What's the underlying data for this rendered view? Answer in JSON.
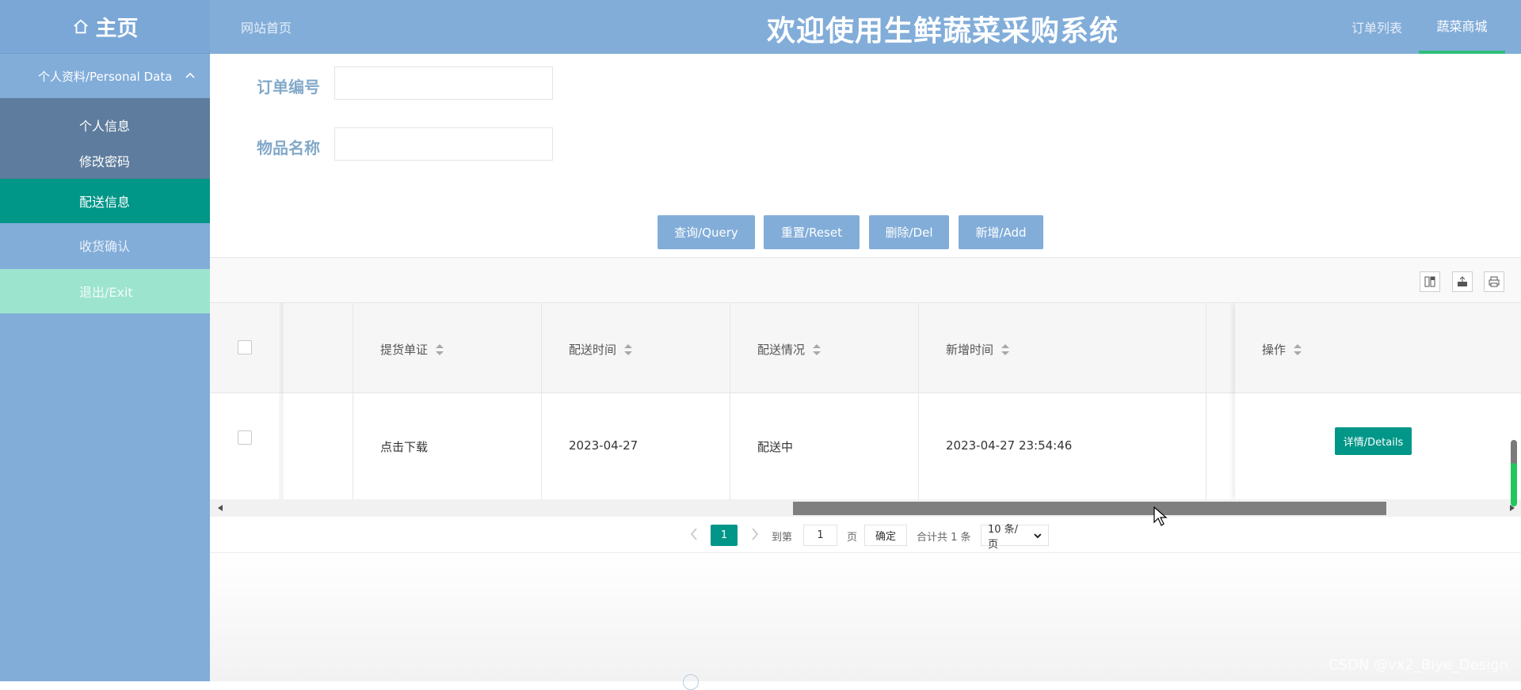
{
  "header": {
    "home_label": "主页",
    "nav_home": "网站首页",
    "title": "欢迎使用生鲜蔬菜采购系统",
    "nav_orders": "订单列表",
    "nav_shop": "蔬菜商城"
  },
  "sidebar": {
    "group_label": "个人资料/Personal Data",
    "sub_items": [
      "个人信息",
      "修改密码"
    ],
    "active_item": "配送信息",
    "receipt_item": "收货确认",
    "exit_item": "退出/Exit"
  },
  "form": {
    "order_no_label": "订单编号",
    "order_no_value": "",
    "item_name_label": "物品名称",
    "item_name_value": ""
  },
  "buttons": {
    "query": "查询/Query",
    "reset": "重置/Reset",
    "delete": "删除/Del",
    "add": "新增/Add"
  },
  "toolbar": {
    "icons": [
      "columns-icon",
      "export-icon",
      "print-icon"
    ]
  },
  "table": {
    "headers": [
      "提货单证",
      "配送时间",
      "配送情况",
      "新增时间",
      "操作"
    ],
    "rows": [
      {
        "proof": "点击下载",
        "delivery_time": "2023-04-27",
        "delivery_status": "配送中",
        "created_time": "2023-04-27 23:54:46",
        "action": "详情/Details"
      }
    ]
  },
  "pagination": {
    "current_page": "1",
    "goto_label": "到第",
    "goto_value": "1",
    "page_unit": "页",
    "confirm": "确定",
    "total": "合计共 1 条",
    "page_size": "10 条/页"
  },
  "watermark": "CSDN @vx2_Biye_Design",
  "colors": {
    "header_bg": "#82add9",
    "active_green": "#009688",
    "sidebar_sub_bg": "#5e7c9d",
    "exit_bg": "#9de4cf"
  }
}
